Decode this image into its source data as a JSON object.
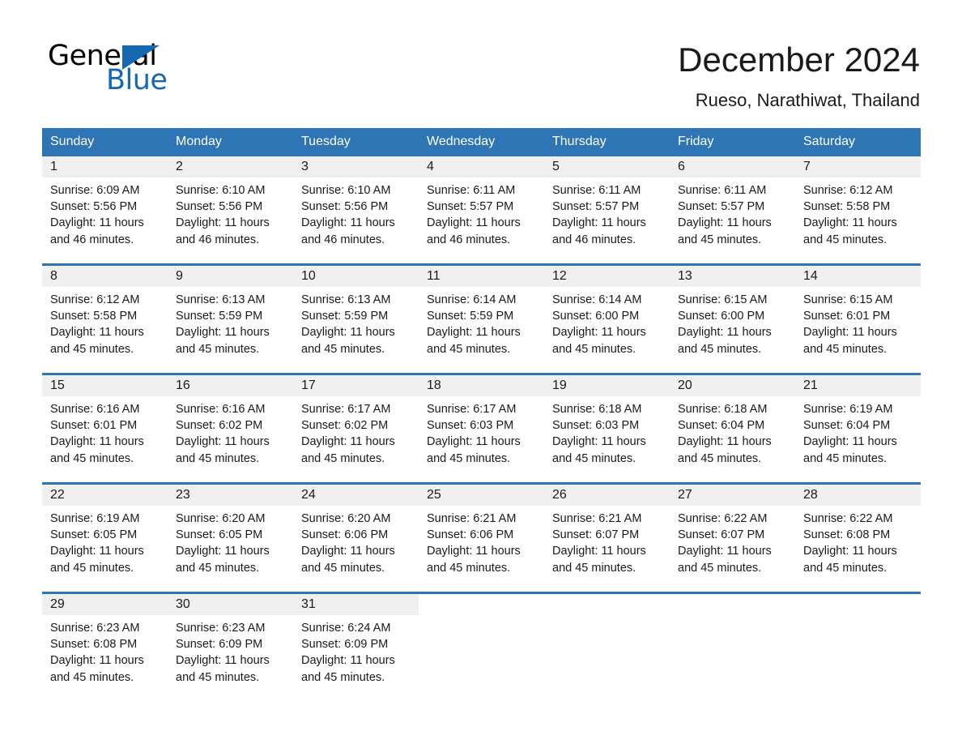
{
  "brand": {
    "name_part1": "General",
    "name_part2": "Blue",
    "accent_color": "#1569b0",
    "triangle_icon": "triangle-icon"
  },
  "header": {
    "title": "December 2024",
    "location": "Rueso, Narathiwat, Thailand"
  },
  "theme": {
    "header_blue": "#2e75b6",
    "daynum_band": "#f0f0f0",
    "text": "#1a1a1a"
  },
  "calendar": {
    "weekday_headers": [
      "Sunday",
      "Monday",
      "Tuesday",
      "Wednesday",
      "Thursday",
      "Friday",
      "Saturday"
    ],
    "weeks": [
      [
        {
          "day": "1",
          "sunrise": "Sunrise: 6:09 AM",
          "sunset": "Sunset: 5:56 PM",
          "daylight": "Daylight: 11 hours and 46 minutes."
        },
        {
          "day": "2",
          "sunrise": "Sunrise: 6:10 AM",
          "sunset": "Sunset: 5:56 PM",
          "daylight": "Daylight: 11 hours and 46 minutes."
        },
        {
          "day": "3",
          "sunrise": "Sunrise: 6:10 AM",
          "sunset": "Sunset: 5:56 PM",
          "daylight": "Daylight: 11 hours and 46 minutes."
        },
        {
          "day": "4",
          "sunrise": "Sunrise: 6:11 AM",
          "sunset": "Sunset: 5:57 PM",
          "daylight": "Daylight: 11 hours and 46 minutes."
        },
        {
          "day": "5",
          "sunrise": "Sunrise: 6:11 AM",
          "sunset": "Sunset: 5:57 PM",
          "daylight": "Daylight: 11 hours and 46 minutes."
        },
        {
          "day": "6",
          "sunrise": "Sunrise: 6:11 AM",
          "sunset": "Sunset: 5:57 PM",
          "daylight": "Daylight: 11 hours and 45 minutes."
        },
        {
          "day": "7",
          "sunrise": "Sunrise: 6:12 AM",
          "sunset": "Sunset: 5:58 PM",
          "daylight": "Daylight: 11 hours and 45 minutes."
        }
      ],
      [
        {
          "day": "8",
          "sunrise": "Sunrise: 6:12 AM",
          "sunset": "Sunset: 5:58 PM",
          "daylight": "Daylight: 11 hours and 45 minutes."
        },
        {
          "day": "9",
          "sunrise": "Sunrise: 6:13 AM",
          "sunset": "Sunset: 5:59 PM",
          "daylight": "Daylight: 11 hours and 45 minutes."
        },
        {
          "day": "10",
          "sunrise": "Sunrise: 6:13 AM",
          "sunset": "Sunset: 5:59 PM",
          "daylight": "Daylight: 11 hours and 45 minutes."
        },
        {
          "day": "11",
          "sunrise": "Sunrise: 6:14 AM",
          "sunset": "Sunset: 5:59 PM",
          "daylight": "Daylight: 11 hours and 45 minutes."
        },
        {
          "day": "12",
          "sunrise": "Sunrise: 6:14 AM",
          "sunset": "Sunset: 6:00 PM",
          "daylight": "Daylight: 11 hours and 45 minutes."
        },
        {
          "day": "13",
          "sunrise": "Sunrise: 6:15 AM",
          "sunset": "Sunset: 6:00 PM",
          "daylight": "Daylight: 11 hours and 45 minutes."
        },
        {
          "day": "14",
          "sunrise": "Sunrise: 6:15 AM",
          "sunset": "Sunset: 6:01 PM",
          "daylight": "Daylight: 11 hours and 45 minutes."
        }
      ],
      [
        {
          "day": "15",
          "sunrise": "Sunrise: 6:16 AM",
          "sunset": "Sunset: 6:01 PM",
          "daylight": "Daylight: 11 hours and 45 minutes."
        },
        {
          "day": "16",
          "sunrise": "Sunrise: 6:16 AM",
          "sunset": "Sunset: 6:02 PM",
          "daylight": "Daylight: 11 hours and 45 minutes."
        },
        {
          "day": "17",
          "sunrise": "Sunrise: 6:17 AM",
          "sunset": "Sunset: 6:02 PM",
          "daylight": "Daylight: 11 hours and 45 minutes."
        },
        {
          "day": "18",
          "sunrise": "Sunrise: 6:17 AM",
          "sunset": "Sunset: 6:03 PM",
          "daylight": "Daylight: 11 hours and 45 minutes."
        },
        {
          "day": "19",
          "sunrise": "Sunrise: 6:18 AM",
          "sunset": "Sunset: 6:03 PM",
          "daylight": "Daylight: 11 hours and 45 minutes."
        },
        {
          "day": "20",
          "sunrise": "Sunrise: 6:18 AM",
          "sunset": "Sunset: 6:04 PM",
          "daylight": "Daylight: 11 hours and 45 minutes."
        },
        {
          "day": "21",
          "sunrise": "Sunrise: 6:19 AM",
          "sunset": "Sunset: 6:04 PM",
          "daylight": "Daylight: 11 hours and 45 minutes."
        }
      ],
      [
        {
          "day": "22",
          "sunrise": "Sunrise: 6:19 AM",
          "sunset": "Sunset: 6:05 PM",
          "daylight": "Daylight: 11 hours and 45 minutes."
        },
        {
          "day": "23",
          "sunrise": "Sunrise: 6:20 AM",
          "sunset": "Sunset: 6:05 PM",
          "daylight": "Daylight: 11 hours and 45 minutes."
        },
        {
          "day": "24",
          "sunrise": "Sunrise: 6:20 AM",
          "sunset": "Sunset: 6:06 PM",
          "daylight": "Daylight: 11 hours and 45 minutes."
        },
        {
          "day": "25",
          "sunrise": "Sunrise: 6:21 AM",
          "sunset": "Sunset: 6:06 PM",
          "daylight": "Daylight: 11 hours and 45 minutes."
        },
        {
          "day": "26",
          "sunrise": "Sunrise: 6:21 AM",
          "sunset": "Sunset: 6:07 PM",
          "daylight": "Daylight: 11 hours and 45 minutes."
        },
        {
          "day": "27",
          "sunrise": "Sunrise: 6:22 AM",
          "sunset": "Sunset: 6:07 PM",
          "daylight": "Daylight: 11 hours and 45 minutes."
        },
        {
          "day": "28",
          "sunrise": "Sunrise: 6:22 AM",
          "sunset": "Sunset: 6:08 PM",
          "daylight": "Daylight: 11 hours and 45 minutes."
        }
      ],
      [
        {
          "day": "29",
          "sunrise": "Sunrise: 6:23 AM",
          "sunset": "Sunset: 6:08 PM",
          "daylight": "Daylight: 11 hours and 45 minutes."
        },
        {
          "day": "30",
          "sunrise": "Sunrise: 6:23 AM",
          "sunset": "Sunset: 6:09 PM",
          "daylight": "Daylight: 11 hours and 45 minutes."
        },
        {
          "day": "31",
          "sunrise": "Sunrise: 6:24 AM",
          "sunset": "Sunset: 6:09 PM",
          "daylight": "Daylight: 11 hours and 45 minutes."
        },
        {
          "day": "",
          "sunrise": "",
          "sunset": "",
          "daylight": ""
        },
        {
          "day": "",
          "sunrise": "",
          "sunset": "",
          "daylight": ""
        },
        {
          "day": "",
          "sunrise": "",
          "sunset": "",
          "daylight": ""
        },
        {
          "day": "",
          "sunrise": "",
          "sunset": "",
          "daylight": ""
        }
      ]
    ]
  }
}
